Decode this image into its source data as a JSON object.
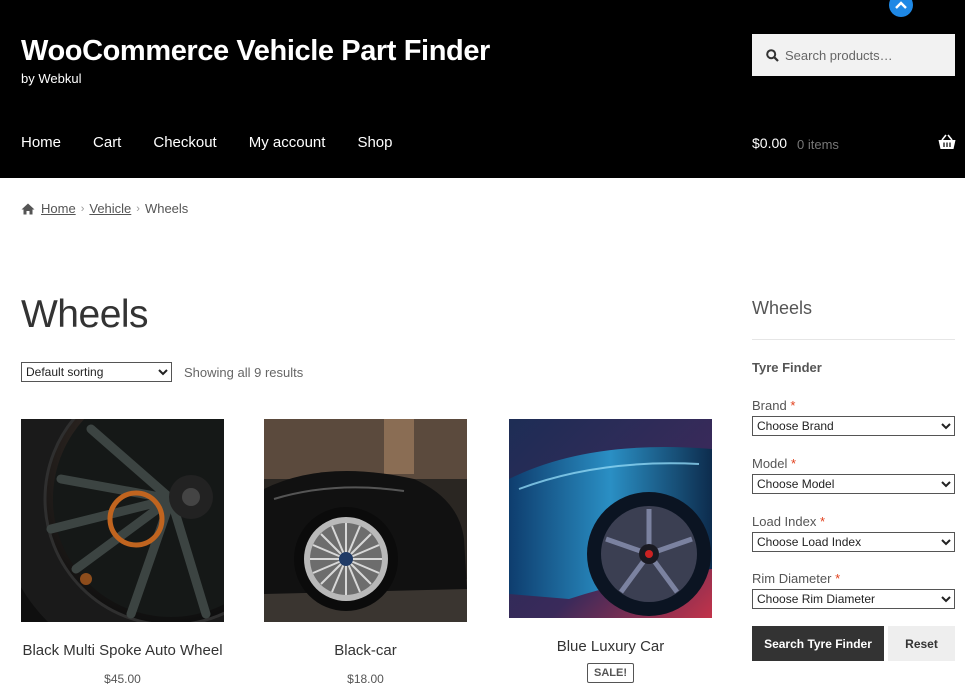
{
  "header": {
    "site_title": "WooCommerce Vehicle Part Finder",
    "tagline": "by Webkul",
    "search_placeholder": "Search products…",
    "nav": [
      "Home",
      "Cart",
      "Checkout",
      "My account",
      "Shop"
    ],
    "cart_total": "$0.00",
    "cart_count": "0 items",
    "colors": {
      "header_bg": "#000000",
      "badge": "#1e88e5"
    }
  },
  "breadcrumb": {
    "items": [
      "Home",
      "Vehicle"
    ],
    "current": "Wheels"
  },
  "main": {
    "title": "Wheels",
    "sort_selected": "Default sorting",
    "result_count": "Showing all 9 results",
    "products": [
      {
        "name": "Black Multi Spoke Auto Wheel",
        "price": "$45.00"
      },
      {
        "name": "Black-car",
        "price": "$18.00"
      },
      {
        "name": "Blue Luxury Car",
        "badge": "SALE!"
      }
    ]
  },
  "sidebar": {
    "title": "Wheels",
    "finder_title": "Tyre Finder",
    "fields": [
      {
        "label": "Brand",
        "required": "*",
        "selected": "Choose Brand"
      },
      {
        "label": "Model",
        "required": "*",
        "selected": "Choose Model"
      },
      {
        "label": "Load Index",
        "required": "*",
        "selected": "Choose Load Index"
      },
      {
        "label": "Rim Diameter",
        "required": "*",
        "selected": "Choose Rim Diameter"
      }
    ],
    "search_button": "Search Tyre Finder",
    "reset_button": "Reset"
  }
}
